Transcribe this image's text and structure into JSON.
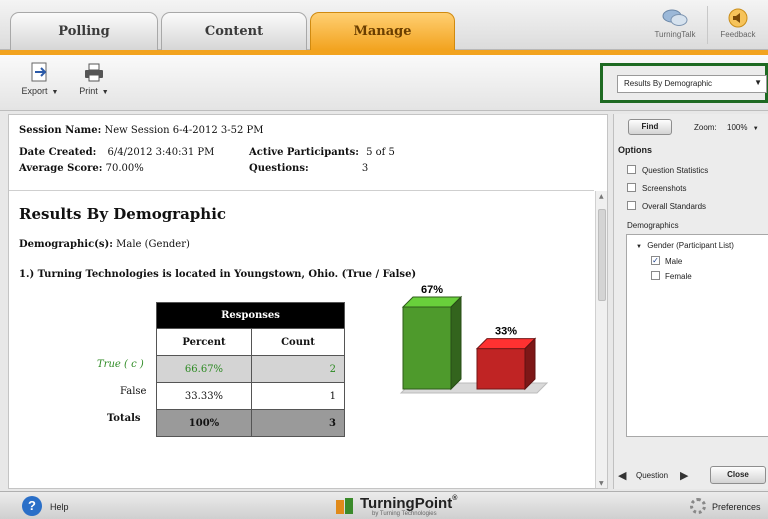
{
  "tabs": [
    {
      "label": "Polling"
    },
    {
      "label": "Content"
    },
    {
      "label": "Manage"
    }
  ],
  "top_icons": {
    "turningtalk": {
      "label": "TurningTalk",
      "icon": "speech-bubbles-icon"
    },
    "feedback": {
      "label": "Feedback",
      "icon": "speaker-icon"
    }
  },
  "toolbar": {
    "export_label": "Export",
    "print_label": "Print",
    "report_type": "Results By Demographic"
  },
  "session": {
    "name_label": "Session Name:",
    "name_value": "New Session 6-4-2012 3-52 PM",
    "created_label": "Date Created:",
    "created_value": "6/4/2012 3:40:31 PM",
    "participants_label": "Active Participants:",
    "participants_value": "5 of 5",
    "avg_label": "Average Score:",
    "avg_value": "70.00%",
    "questions_label": "Questions:",
    "questions_value": "3"
  },
  "report": {
    "title": "Results By Demographic",
    "demographic_label": "Demographic(s):",
    "demographic_value": "Male (Gender)",
    "question": "1.) Turning Technologies is located in Youngstown, Ohio. (True / False)",
    "table": {
      "header": "Responses",
      "columns": [
        "Percent",
        "Count"
      ],
      "rows": [
        {
          "label": "True ( c )",
          "percent": "66.67%",
          "count": "2",
          "correct": true
        },
        {
          "label": "False",
          "percent": "33.33%",
          "count": "1",
          "correct": false
        }
      ],
      "totals": {
        "label": "Totals",
        "percent": "100%",
        "count": "3"
      }
    }
  },
  "chart_data": {
    "type": "bar",
    "categories": [
      "True ( c )",
      "False"
    ],
    "values": [
      67,
      33
    ],
    "value_labels": [
      "67%",
      "33%"
    ],
    "colors": [
      "#4e9a2c",
      "#c02424"
    ]
  },
  "right_panel": {
    "find_label": "Find",
    "zoom_label": "Zoom:",
    "zoom_value": "100%",
    "options_title": "Options",
    "options": [
      {
        "label": "Question Statistics",
        "checked": false
      },
      {
        "label": "Screenshots",
        "checked": false
      },
      {
        "label": "Overall Standards",
        "checked": false
      }
    ],
    "demographics_title": "Demographics",
    "demo_group": "Gender (Participant List)",
    "demo_items": [
      {
        "label": "Male",
        "checked": true
      },
      {
        "label": "Female",
        "checked": false
      }
    ],
    "question_nav_label": "Question",
    "close_label": "Close"
  },
  "bottom": {
    "help_label": "Help",
    "brand": "TurningPoint",
    "brand_suffix": "®",
    "brand_sub": "by Turning Technologies",
    "preferences_label": "Preferences"
  },
  "colors": {
    "accent": "#f2a31f",
    "correct_text": "#2c8a22",
    "highlight_frame": "#1e6a22"
  }
}
